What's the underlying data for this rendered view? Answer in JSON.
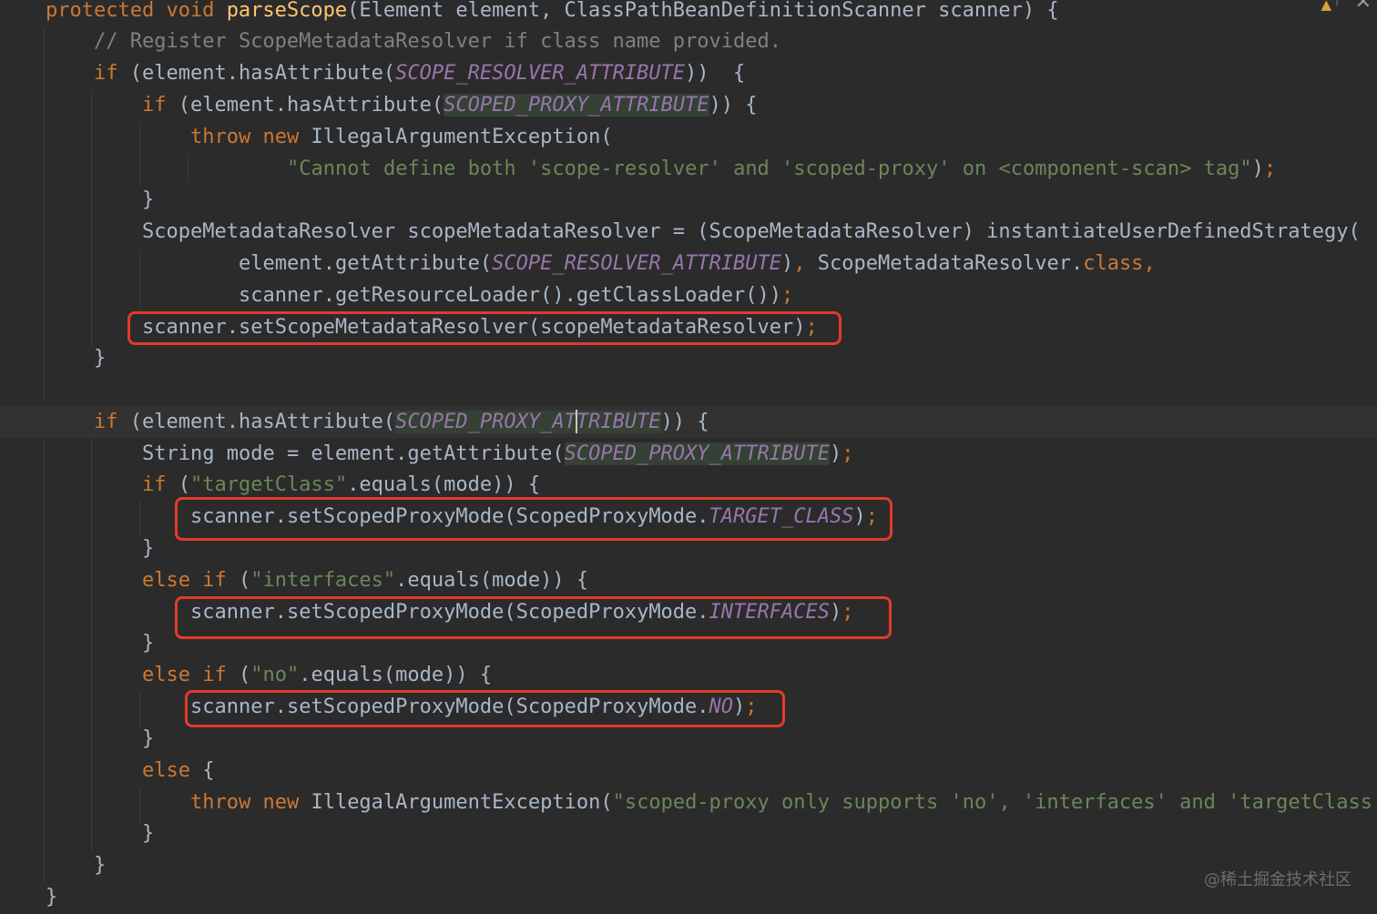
{
  "editor": {
    "lines": [
      {
        "id": "l1",
        "tokens": [
          [
            "kw",
            "protected void "
          ],
          [
            "fn",
            "parseScope"
          ],
          [
            "",
            "(Element element, ClassPathBeanDefinitionScanner scanner) {"
          ]
        ]
      },
      {
        "id": "l2",
        "tokens": [
          [
            "cmt",
            "// Register ScopeMetadataResolver if class name provided."
          ]
        ]
      },
      {
        "id": "l3",
        "tokens": [
          [
            "kw",
            "if "
          ],
          [
            "",
            "(element.hasAttribute("
          ],
          [
            "cst",
            "SCOPE_RESOLVER_ATTRIBUTE"
          ],
          [
            "",
            "))  {"
          ]
        ]
      },
      {
        "id": "l4",
        "tokens": [
          [
            "kw",
            "if "
          ],
          [
            "",
            "(element.hasAttribute("
          ],
          [
            "cst hl",
            "SCOPED_PROXY_ATTRIBUTE"
          ],
          [
            "",
            ")) {"
          ]
        ]
      },
      {
        "id": "l5",
        "tokens": [
          [
            "kw",
            "throw new "
          ],
          [
            "",
            "IllegalArgumentException("
          ]
        ]
      },
      {
        "id": "l6",
        "tokens": [
          [
            "str",
            "\"Cannot define both 'scope-resolver' and 'scoped-proxy' on <component-scan> tag\""
          ],
          [
            "",
            ")"
          ],
          [
            "sem",
            ";"
          ]
        ]
      },
      {
        "id": "l7",
        "tokens": [
          [
            "",
            "}"
          ]
        ]
      },
      {
        "id": "l8",
        "tokens": [
          [
            "",
            "ScopeMetadataResolver scopeMetadataResolver = (ScopeMetadataResolver) instantiateUserDefinedStrategy("
          ]
        ]
      },
      {
        "id": "l9",
        "tokens": [
          [
            "",
            "element.getAttribute("
          ],
          [
            "cst",
            "SCOPE_RESOLVER_ATTRIBUTE"
          ],
          [
            "",
            ")"
          ],
          [
            "sem",
            ", "
          ],
          [
            "",
            "ScopeMetadataResolver."
          ],
          [
            "kw",
            "class"
          ],
          [
            "sem",
            ","
          ]
        ]
      },
      {
        "id": "l10",
        "tokens": [
          [
            "",
            "scanner.getResourceLoader().getClassLoader())"
          ],
          [
            "sem",
            ";"
          ]
        ]
      },
      {
        "id": "l11",
        "tokens": [
          [
            "",
            "scanner.setScopeMetadataResolver(scopeMetadataResolver)"
          ],
          [
            "sem",
            ";"
          ]
        ]
      },
      {
        "id": "l12",
        "tokens": [
          [
            "",
            "}"
          ]
        ]
      },
      {
        "id": "l13",
        "tokens": []
      },
      {
        "id": "l14",
        "tokens": [
          [
            "kw",
            "if "
          ],
          [
            "",
            "(element.hasAttribute("
          ],
          [
            "cst hl",
            "SCOPED_PROXY_ATTRIBUTE"
          ],
          [
            "",
            ")) {"
          ]
        ]
      },
      {
        "id": "l15",
        "tokens": [
          [
            "",
            "String mode = element.getAttribute("
          ],
          [
            "cst hl",
            "SCOPED_PROXY_ATTRIBUTE"
          ],
          [
            "",
            ")"
          ],
          [
            "sem",
            ";"
          ]
        ]
      },
      {
        "id": "l16",
        "tokens": [
          [
            "kw",
            "if "
          ],
          [
            "",
            "("
          ],
          [
            "str",
            "\"targetClass\""
          ],
          [
            "",
            ".equals(mode)) {"
          ]
        ]
      },
      {
        "id": "l17",
        "tokens": [
          [
            "",
            "scanner.setScopedProxyMode(ScopedProxyMode."
          ],
          [
            "cst",
            "TARGET_CLASS"
          ],
          [
            "",
            ")"
          ],
          [
            "sem",
            ";"
          ]
        ]
      },
      {
        "id": "l18",
        "tokens": [
          [
            "",
            "}"
          ]
        ]
      },
      {
        "id": "l19",
        "tokens": [
          [
            "kw",
            "else if "
          ],
          [
            "",
            "("
          ],
          [
            "str",
            "\"interfaces\""
          ],
          [
            "",
            ".equals(mode)) {"
          ]
        ]
      },
      {
        "id": "l20",
        "tokens": [
          [
            "",
            "scanner.setScopedProxyMode(ScopedProxyMode."
          ],
          [
            "cst",
            "INTERFACES"
          ],
          [
            "",
            ")"
          ],
          [
            "sem",
            ";"
          ]
        ]
      },
      {
        "id": "l21",
        "tokens": [
          [
            "",
            "}"
          ]
        ]
      },
      {
        "id": "l22",
        "tokens": [
          [
            "kw",
            "else if "
          ],
          [
            "",
            "("
          ],
          [
            "str",
            "\"no\""
          ],
          [
            "",
            ".equals(mode)) {"
          ]
        ]
      },
      {
        "id": "l23",
        "tokens": [
          [
            "",
            "scanner.setScopedProxyMode(ScopedProxyMode."
          ],
          [
            "cst",
            "NO"
          ],
          [
            "",
            ")"
          ],
          [
            "sem",
            ";"
          ]
        ]
      },
      {
        "id": "l24",
        "tokens": [
          [
            "",
            "}"
          ]
        ]
      },
      {
        "id": "l25",
        "tokens": [
          [
            "kw",
            "else "
          ],
          [
            "",
            "{"
          ]
        ]
      },
      {
        "id": "l26",
        "tokens": [
          [
            "kw",
            "throw new "
          ],
          [
            "",
            "IllegalArgumentException("
          ],
          [
            "str",
            "\"scoped-proxy only supports 'no', 'interfaces' and 'targetClass"
          ]
        ]
      },
      {
        "id": "l27",
        "tokens": [
          [
            "",
            "}"
          ]
        ]
      },
      {
        "id": "l28",
        "tokens": [
          [
            "",
            "}"
          ]
        ]
      },
      {
        "id": "l29",
        "tokens": [
          [
            "",
            "}"
          ]
        ]
      }
    ]
  },
  "toolbar": {
    "warning_icon": "warning-icon",
    "warning_text": "▲",
    "arrow_text": "↑",
    "close_text": "✕"
  },
  "watermark": {
    "text": "@稀土掘金技术社区"
  },
  "colors": {
    "background": "#2b2b2b",
    "keyword": "#cc7832",
    "method": "#ffc66d",
    "comment": "#808080",
    "string": "#6a8759",
    "constant": "#9876aa",
    "highlight_box": "#e23b2a"
  }
}
